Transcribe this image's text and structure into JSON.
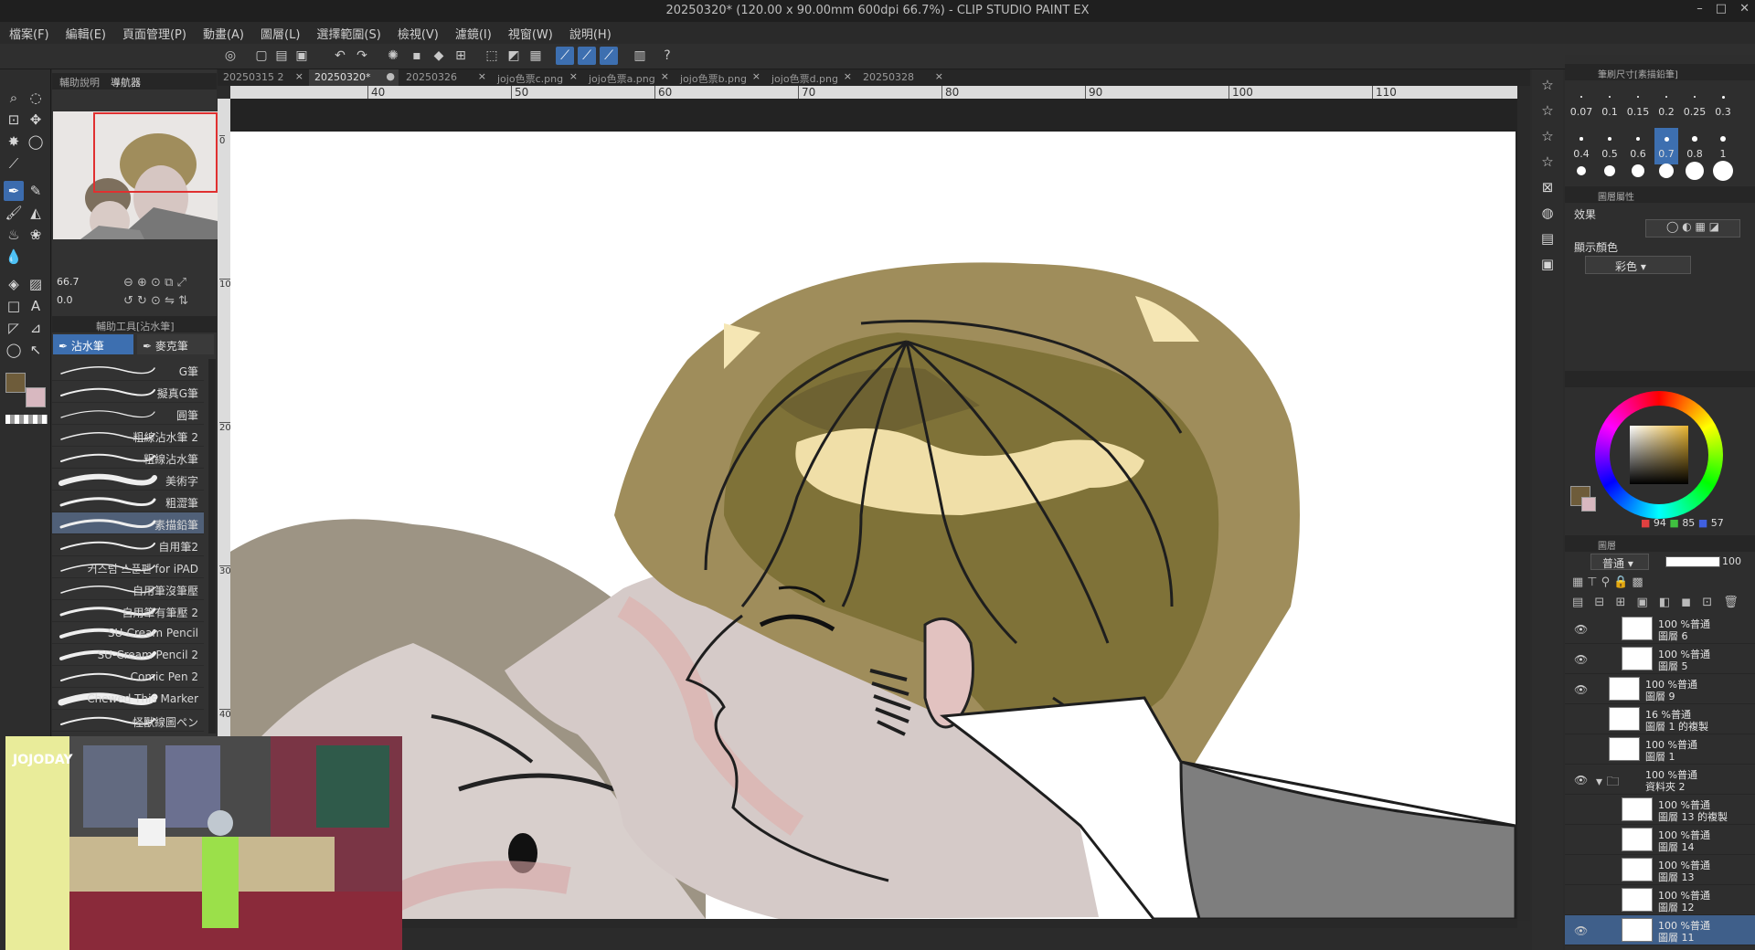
{
  "window": {
    "title": "20250320* (120.00 x 90.00mm 600dpi 66.7%) - CLIP STUDIO PAINT EX",
    "controls": [
      "–",
      "□",
      "✕"
    ]
  },
  "menu": [
    "檔案(F)",
    "編輯(E)",
    "頁面管理(P)",
    "動畫(A)",
    "圖層(L)",
    "選擇範圍(S)",
    "檢視(V)",
    "濾鏡(I)",
    "視窗(W)",
    "說明(H)"
  ],
  "tabs": [
    {
      "label": "20250315 2",
      "active": false
    },
    {
      "label": "20250320*",
      "active": true
    },
    {
      "label": "20250326",
      "active": false
    },
    {
      "label": "jojo色票c.png",
      "active": false
    },
    {
      "label": "jojo色票a.png",
      "active": false
    },
    {
      "label": "jojo色票b.png",
      "active": false
    },
    {
      "label": "jojo色票d.png",
      "active": false
    },
    {
      "label": "20250328",
      "active": false
    }
  ],
  "left_panel": {
    "navigator_tabs": [
      "輔助說明",
      "導航器"
    ],
    "zoom": "66.7",
    "rotation": "0.0",
    "subtool_header": "輔助工具[沾水筆]",
    "subtool_tabs": [
      "沾水筆",
      "麥克筆"
    ],
    "brushes": [
      "G筆",
      "擬真G筆",
      "圓筆",
      "粗線沾水筆 2",
      "粗線沾水筆",
      "美術字",
      "粗澀筆",
      "素描鉛筆",
      "自用筆2",
      "커스텀 스푼펜 for iPAD",
      "自用筆沒筆壓",
      "自用筆有筆壓 2",
      "SU-Cream Pencil",
      "SU-Cream Pencil 2",
      "Comic Pen 2",
      "Chewed This Marker",
      "怪獸線圖ペン"
    ],
    "selected_brush": "素描鉛筆"
  },
  "ruler": {
    "h_ticks": [
      "40",
      "50",
      "60",
      "70",
      "80",
      "90",
      "100",
      "110"
    ],
    "v_ticks": [
      "0",
      "10",
      "20",
      "30",
      "40"
    ]
  },
  "brush_size": {
    "tab_label": "筆刷尺寸[素描鉛筆]",
    "values": [
      "0.07",
      "0.1",
      "0.15",
      "0.2",
      "0.25",
      "0.3",
      "0.4",
      "0.5",
      "0.6",
      "0.7",
      "0.8",
      "1"
    ],
    "selected": "0.7"
  },
  "layer_property": {
    "title": "圖層屬性",
    "effect_label": "效果",
    "display_color_label": "顯示顏色",
    "display_color_value": "彩色"
  },
  "color_wheel": {
    "h": "94",
    "s": "85",
    "v": "57",
    "main_color": "#6e5c3a",
    "sub_color": "#d8b8c0"
  },
  "layers_panel": {
    "tab_label": "圖層",
    "blend_mode": "普通",
    "opacity": "100",
    "layers": [
      {
        "line1": "100 %普通",
        "line2": "圖層 6",
        "visible": true,
        "selected": false,
        "indent": 1
      },
      {
        "line1": "100 %普通",
        "line2": "圖層 5",
        "visible": true,
        "selected": false,
        "indent": 1
      },
      {
        "line1": "100 %普通",
        "line2": "圖層 9",
        "visible": true,
        "selected": false,
        "indent": 0
      },
      {
        "line1": "16 %普通",
        "line2": "圖層 1 的複製",
        "visible": false,
        "selected": false,
        "indent": 0
      },
      {
        "line1": "100 %普通",
        "line2": "圖層 1",
        "visible": false,
        "selected": false,
        "indent": 0
      },
      {
        "line1": "100 %普通",
        "line2": "資料夾 2",
        "visible": true,
        "selected": false,
        "indent": 0,
        "folder": true
      },
      {
        "line1": "100 %普通",
        "line2": "圖層 13 的複製",
        "visible": false,
        "selected": false,
        "indent": 1
      },
      {
        "line1": "100 %普通",
        "line2": "圖層 14",
        "visible": false,
        "selected": false,
        "indent": 1
      },
      {
        "line1": "100 %普通",
        "line2": "圖層 13",
        "visible": false,
        "selected": false,
        "indent": 1
      },
      {
        "line1": "100 %普通",
        "line2": "圖層 12",
        "visible": false,
        "selected": false,
        "indent": 1
      },
      {
        "line1": "100 %普通",
        "line2": "圖層 11",
        "visible": true,
        "selected": true,
        "indent": 1
      }
    ]
  },
  "video_overlay": {
    "logo": "JOJODAY"
  }
}
